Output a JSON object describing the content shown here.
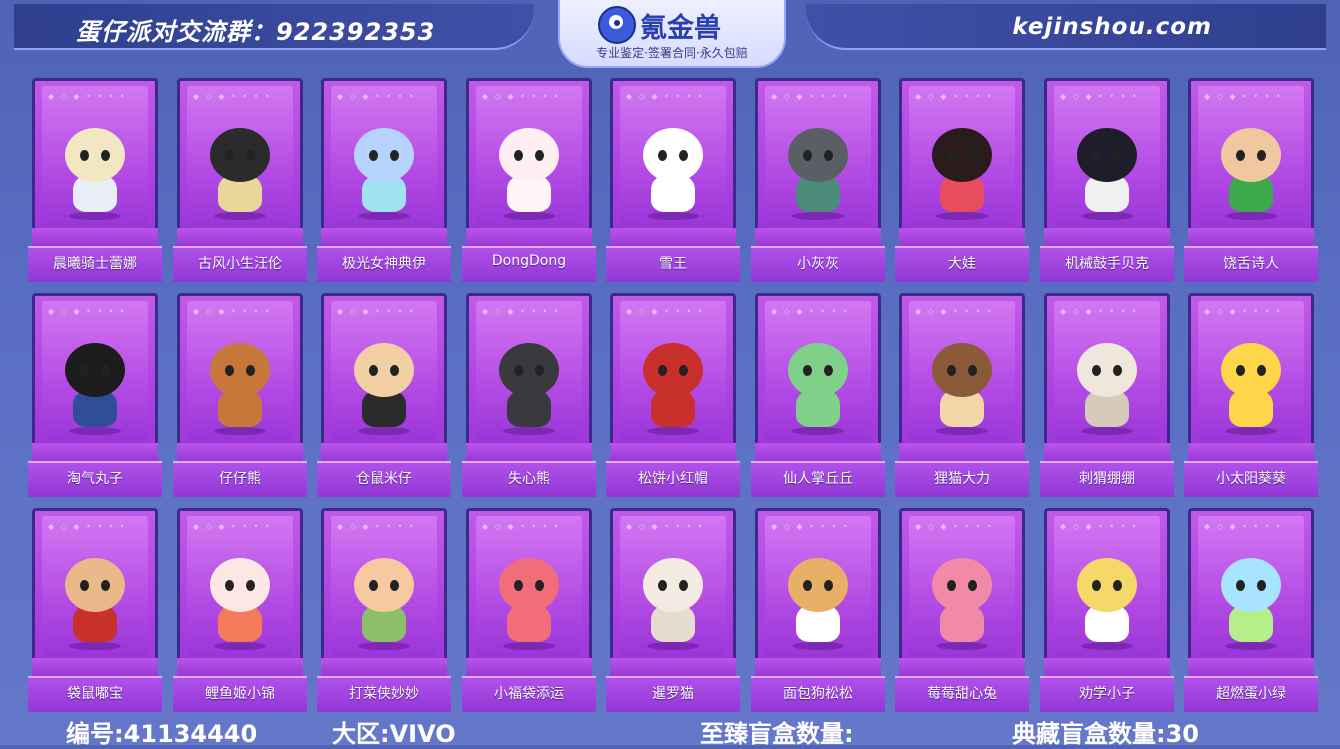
{
  "header": {
    "group_text": "蛋仔派对交流群：922392353",
    "logo_name": "氪金兽",
    "logo_slogan": "专业鉴定·签署合同·永久包赔",
    "site_text": "kejinshou.com"
  },
  "cards": [
    {
      "label": "晨曦骑士蕾娜",
      "icon": "knight-figure-icon",
      "head": "#f3e6c2",
      "body": "#e9eef5"
    },
    {
      "label": "古风小生汪伦",
      "icon": "scholar-figure-icon",
      "head": "#2b2b2b",
      "body": "#e8d79a"
    },
    {
      "label": "极光女神典伊",
      "icon": "goddess-figure-icon",
      "head": "#b7d3ff",
      "body": "#9fe3f0"
    },
    {
      "label": "DongDong",
      "icon": "sheep-figure-icon",
      "head": "#ffeef2",
      "body": "#fff5f7"
    },
    {
      "label": "雪王",
      "icon": "snow-king-figure-icon",
      "head": "#ffffff",
      "body": "#ffffff"
    },
    {
      "label": "小灰灰",
      "icon": "wolf-figure-icon",
      "head": "#5a5f66",
      "body": "#4c8a7a"
    },
    {
      "label": "大娃",
      "icon": "calabash-boy-figure-icon",
      "head": "#2a1c1c",
      "body": "#e94c5c"
    },
    {
      "label": "机械鼓手贝克",
      "icon": "robot-drummer-figure-icon",
      "head": "#1e1e2a",
      "body": "#f0f0f0"
    },
    {
      "label": "饶舌诗人",
      "icon": "rapper-figure-icon",
      "head": "#f0c8a0",
      "body": "#3caa4c"
    },
    {
      "label": "淘气丸子",
      "icon": "schoolgirl-figure-icon",
      "head": "#1c1c1c",
      "body": "#2e4e9a"
    },
    {
      "label": "仔仔熊",
      "icon": "bear-figure-icon",
      "head": "#c8773a",
      "body": "#c8773a"
    },
    {
      "label": "仓鼠米仔",
      "icon": "hamster-figure-icon",
      "head": "#f2cfa4",
      "body": "#2a2a2a"
    },
    {
      "label": "失心熊",
      "icon": "dark-bear-figure-icon",
      "head": "#3a3a3e",
      "body": "#3a3a3e"
    },
    {
      "label": "松饼小红帽",
      "icon": "red-hood-figure-icon",
      "head": "#c9302c",
      "body": "#c9302c"
    },
    {
      "label": "仙人掌丘丘",
      "icon": "cactus-figure-icon",
      "head": "#7fd18a",
      "body": "#7fd18a"
    },
    {
      "label": "狸猫大力",
      "icon": "raccoon-figure-icon",
      "head": "#8a5a3a",
      "body": "#f2d6a8"
    },
    {
      "label": "刺猬绷绷",
      "icon": "hedgehog-figure-icon",
      "head": "#efe6dc",
      "body": "#d8cabb"
    },
    {
      "label": "小太阳葵葵",
      "icon": "sunflower-figure-icon",
      "head": "#ffd54a",
      "body": "#ffd54a"
    },
    {
      "label": "袋鼠嘟宝",
      "icon": "kangaroo-figure-icon",
      "head": "#e9b98a",
      "body": "#c9302c"
    },
    {
      "label": "鲤鱼姬小锦",
      "icon": "koi-princess-figure-icon",
      "head": "#fbe8e4",
      "body": "#f47a5a"
    },
    {
      "label": "打菜侠妙妙",
      "icon": "chef-girl-figure-icon",
      "head": "#f6c9a0",
      "body": "#8bbf6a"
    },
    {
      "label": "小福袋添运",
      "icon": "lucky-bag-figure-icon",
      "head": "#f26d7a",
      "body": "#f26d7a"
    },
    {
      "label": "暹罗猫",
      "icon": "siamese-cat-figure-icon",
      "head": "#f3ebe2",
      "body": "#e6dbcf"
    },
    {
      "label": "面包狗松松",
      "icon": "bread-dog-figure-icon",
      "head": "#e8b066",
      "body": "#ffffff"
    },
    {
      "label": "莓莓甜心兔",
      "icon": "rabbit-figure-icon",
      "head": "#f08aa8",
      "body": "#f08aa8"
    },
    {
      "label": "劝学小子",
      "icon": "student-boy-figure-icon",
      "head": "#f5d86a",
      "body": "#ffffff"
    },
    {
      "label": "超燃蛋小绿",
      "icon": "green-egg-figure-icon",
      "head": "#a8e3ff",
      "body": "#b6ef8a"
    }
  ],
  "footer": {
    "id_text": "编号:41134440",
    "region_text": "大区:VIVO",
    "supreme_box_text": "至臻盲盒数量:",
    "collection_box_text": "典藏盲盒数量:30"
  }
}
